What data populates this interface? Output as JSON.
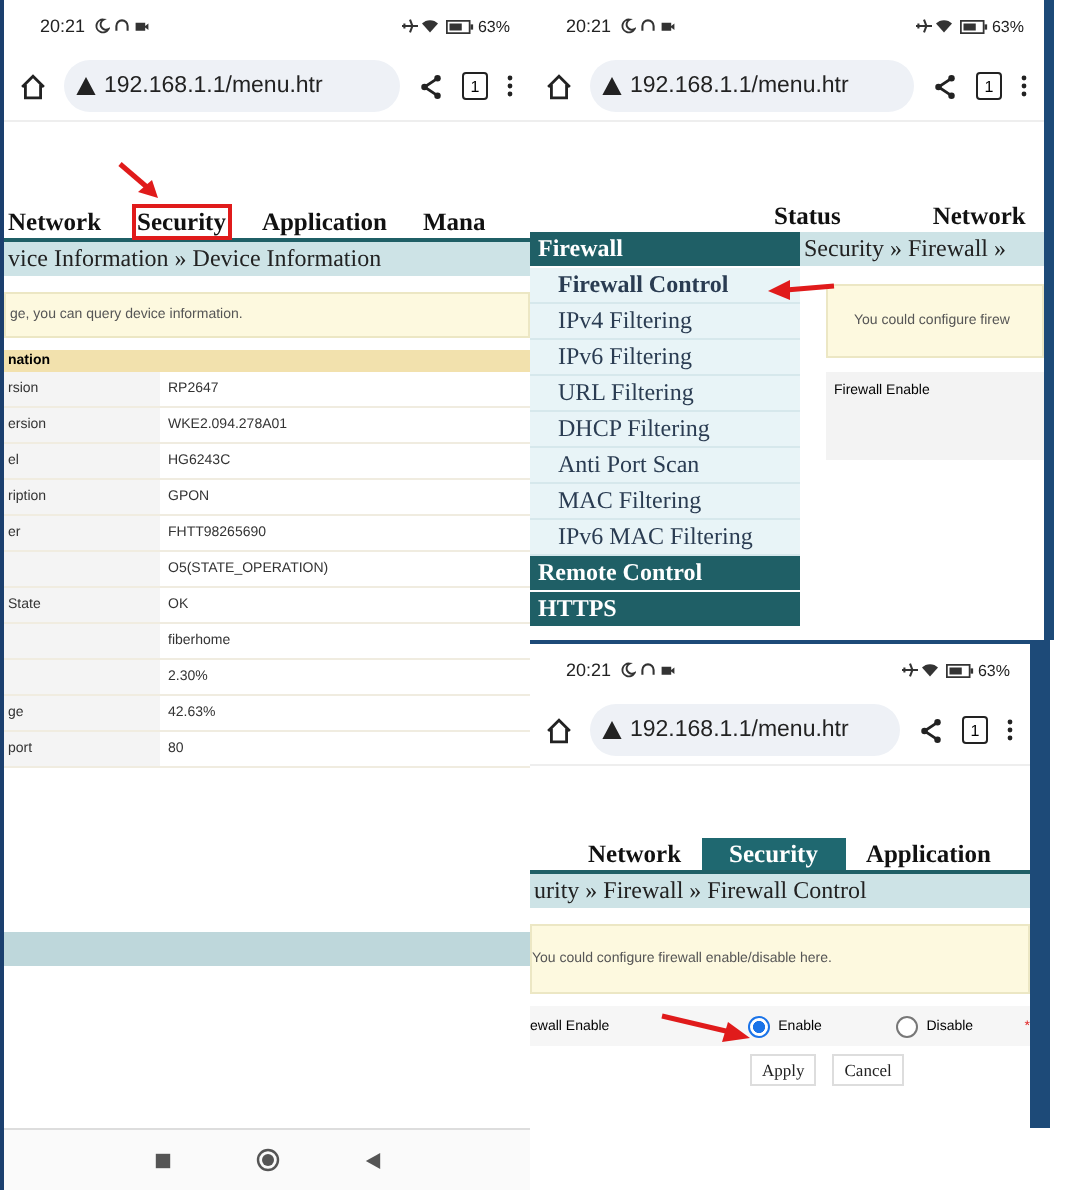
{
  "device_info_screen": {
    "status_bar": {
      "time": "20:21",
      "battery": "63%"
    },
    "address_bar": {
      "url": "192.168.1.1/menu.htr",
      "tab_count": "1"
    },
    "nav_tabs": [
      {
        "label": "Network",
        "selected": false,
        "highlighted": false
      },
      {
        "label": "Security",
        "selected": false,
        "highlighted": true
      },
      {
        "label": "Application",
        "selected": false,
        "highlighted": false
      },
      {
        "label": "Mana",
        "selected": false,
        "highlighted": false
      }
    ],
    "breadcrumb": "vice Information » Device Information",
    "notice": "ge, you can query device information.",
    "table": {
      "header": "nation",
      "rows": [
        {
          "column_1": "rsion",
          "column_2": "RP2647"
        },
        {
          "column_1": "ersion",
          "column_2": "WKE2.094.278A01"
        },
        {
          "column_1": "el",
          "column_2": "HG6243C"
        },
        {
          "column_1": "ription",
          "column_2": "GPON"
        },
        {
          "column_1": "er",
          "column_2": "FHTT98265690"
        },
        {
          "column_2": "O5(STATE_OPERATION)"
        },
        {
          "column_1": "State",
          "column_2": "OK"
        },
        {
          "column_2": "fiberhome"
        },
        {
          "column_2": "2.30%"
        },
        {
          "column_1": "ge",
          "column_2": "42.63%"
        },
        {
          "column_1": "port",
          "column_2": "80"
        }
      ]
    }
  },
  "firewall_menu_screen": {
    "status_bar": {
      "time": "20:21",
      "battery": "63%"
    },
    "address_bar": {
      "url": "192.168.1.1/menu.htr",
      "tab_count": "1"
    },
    "nav_tabs": [
      {
        "label": "Status",
        "selected": false
      },
      {
        "label": "Network",
        "selected": false
      }
    ],
    "sidebar": [
      {
        "label": "Firewall",
        "children": [
          {
            "label": "Firewall Control",
            "selected": true
          },
          {
            "label": "IPv4 Filtering",
            "selected": false
          },
          {
            "label": "IPv6 Filtering",
            "selected": false
          },
          {
            "label": "URL Filtering",
            "selected": false
          },
          {
            "label": "DHCP Filtering",
            "selected": false
          },
          {
            "label": "Anti Port Scan",
            "selected": false
          },
          {
            "label": "MAC Filtering",
            "selected": false
          },
          {
            "label": "IPv6 MAC Filtering",
            "selected": false
          }
        ]
      },
      {
        "label": "Remote Control"
      },
      {
        "label": "HTTPS"
      }
    ],
    "breadcrumb": "Security » Firewall »",
    "notice": "You could configure firew",
    "field_label": "Firewall Enable"
  },
  "firewall_control_screen": {
    "status_bar": {
      "time": "20:21",
      "battery": "63%"
    },
    "address_bar": {
      "url": "192.168.1.1/menu.htr",
      "tab_count": "1"
    },
    "nav_tabs": [
      {
        "label": "Network",
        "selected": false
      },
      {
        "label": "Security",
        "selected": true
      },
      {
        "label": "Application",
        "selected": false
      }
    ],
    "breadcrumb": "urity » Firewall » Firewall Control",
    "notice": "You could configure firewall enable/disable here.",
    "field_label": "ewall Enable",
    "options": [
      {
        "label": "Enable",
        "selected": true
      },
      {
        "label": "Disable",
        "selected": false
      }
    ],
    "required_mark": "*",
    "buttons": [
      "Apply",
      "Cancel"
    ]
  }
}
